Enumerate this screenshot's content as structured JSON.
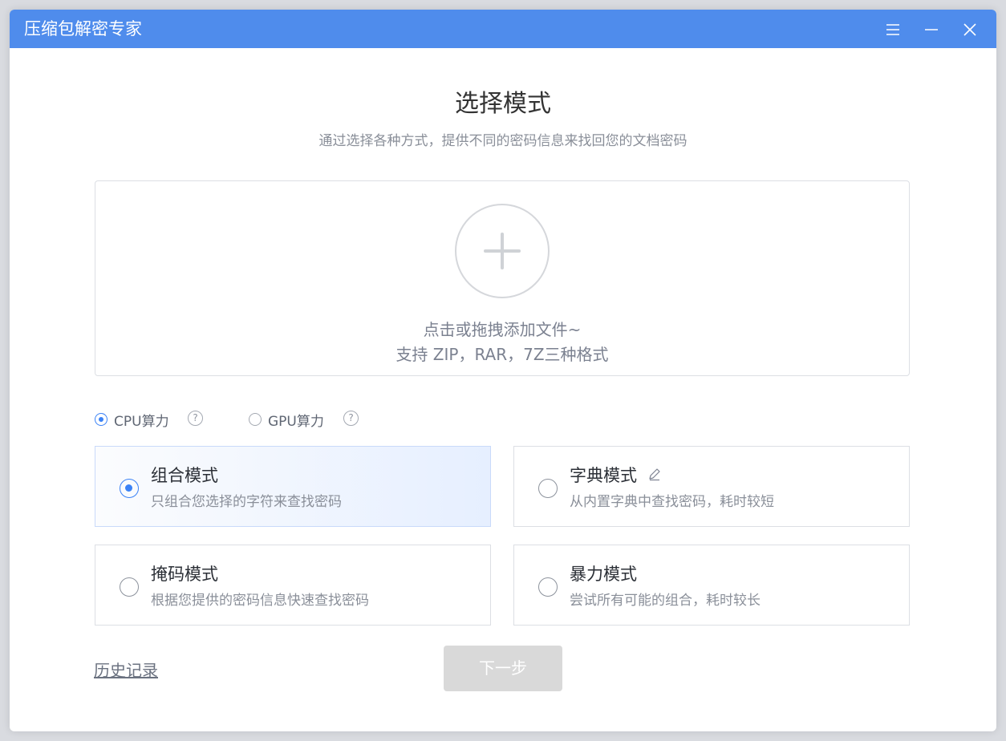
{
  "app": {
    "title": "压缩包解密专家"
  },
  "window_controls": [
    "menu-icon",
    "minimize-icon",
    "close-icon"
  ],
  "header": {
    "title": "选择模式",
    "subtitle": "通过选择各种方式，提供不同的密码信息来找回您的文档密码"
  },
  "dropzone": {
    "hint": "点击或拖拽添加文件~",
    "formats": "支持 ZIP，RAR，7Z三种格式",
    "icon": "plus-icon"
  },
  "compute": {
    "options": [
      {
        "label": "CPU算力",
        "checked": true
      },
      {
        "label": "GPU算力",
        "checked": false
      }
    ],
    "help_glyph": "?"
  },
  "modes": [
    {
      "title": "组合模式",
      "desc": "只组合您选择的字符来查找密码",
      "selected": true
    },
    {
      "title": "字典模式",
      "desc": "从内置字典中查找密码，耗时较短",
      "selected": false,
      "icon": "edit-icon"
    },
    {
      "title": "掩码模式",
      "desc": "根据您提供的密码信息快速查找密码",
      "selected": false
    },
    {
      "title": "暴力模式",
      "desc": "尝试所有可能的组合，耗时较长",
      "selected": false
    }
  ],
  "footer": {
    "history_label": "历史记录",
    "next_label": "下一步",
    "next_enabled": false
  },
  "colors": {
    "titlebar": "#4f8cec",
    "accent": "#3b82f6",
    "disabled_button": "#d9d9d9"
  }
}
